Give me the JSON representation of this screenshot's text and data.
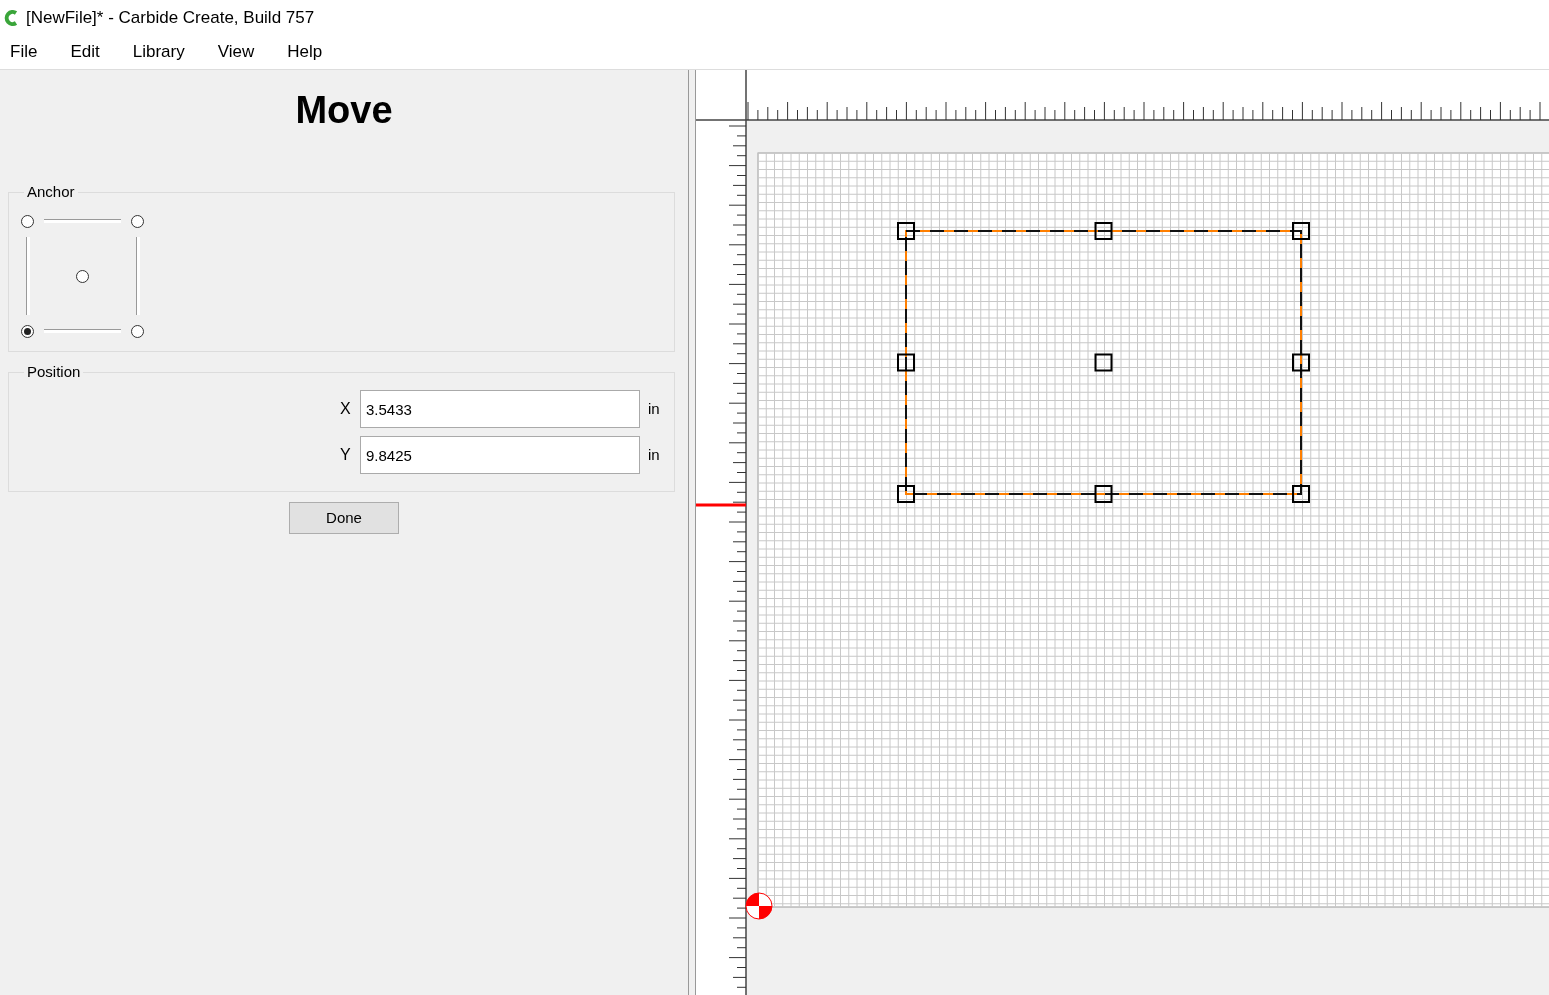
{
  "window": {
    "title": "[NewFile]* - Carbide Create, Build 757"
  },
  "menu": [
    "File",
    "Edit",
    "Library",
    "View",
    "Help"
  ],
  "panel": {
    "title": "Move",
    "anchor": {
      "label": "Anchor",
      "options": [
        {
          "kind": "top-left",
          "selected": false
        },
        {
          "kind": "top-right",
          "selected": false
        },
        {
          "kind": "center",
          "selected": false
        },
        {
          "kind": "bottom-left",
          "selected": true
        },
        {
          "kind": "bottom-right",
          "selected": false
        }
      ]
    },
    "position": {
      "label": "Position",
      "fields": [
        {
          "label": "X",
          "value": "3.5433",
          "unit": "in"
        },
        {
          "label": "Y",
          "value": "9.8425",
          "unit": "in"
        }
      ]
    },
    "button": "Done"
  }
}
